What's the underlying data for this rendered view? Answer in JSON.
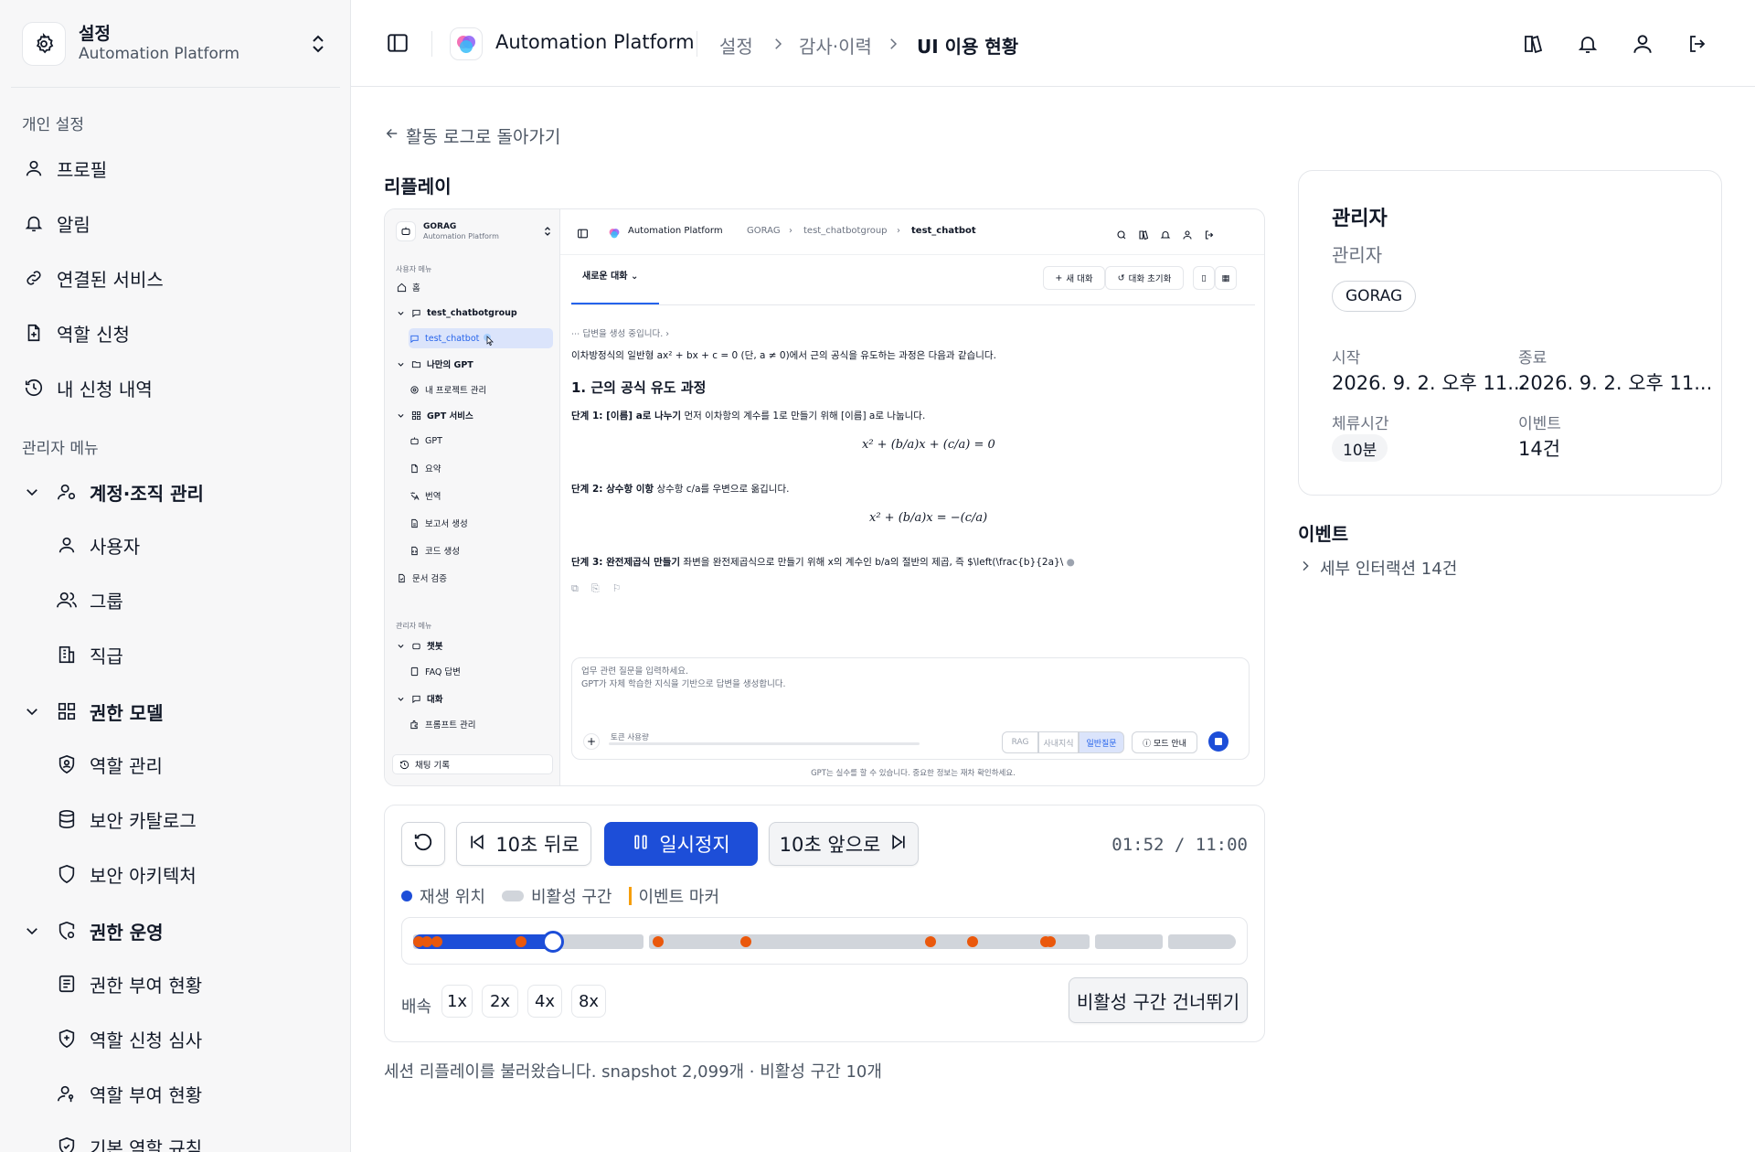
{
  "sidebar": {
    "workspace": {
      "title": "설정",
      "subtitle": "Automation Platform"
    },
    "personal_section": "개인 설정",
    "personal_items": [
      "프로필",
      "알림",
      "연결된 서비스",
      "역할 신청",
      "내 신청 내역"
    ],
    "admin_section": "관리자 메뉴",
    "groups": [
      {
        "label": "계정·조직 관리",
        "items": [
          "사용자",
          "그룹",
          "직급"
        ]
      },
      {
        "label": "권한 모델",
        "items": [
          "역할 관리",
          "보안 카탈로그",
          "보안 아키텍처"
        ]
      },
      {
        "label": "권한 운영",
        "items": [
          "권한 부여 현황",
          "역할 신청 심사",
          "역할 부여 현황",
          "기본 역할 규칙"
        ]
      }
    ]
  },
  "topbar": {
    "app_name": "Automation Platform",
    "breadcrumb": [
      "설정",
      "감사·이력",
      "UI 이용 현황"
    ]
  },
  "main": {
    "back_link": "활동 로그로 돌아가기",
    "replay_title": "리플레이",
    "status_text": "세션 리플레이를 불러왔습니다. snapshot 2,099개 · 비활성 구간 10개"
  },
  "replay": {
    "sidebar": {
      "workspace_title": "GORAG",
      "workspace_sub": "Automation Platform",
      "user_section": "사용자 메뉴",
      "admin_section": "관리자 메뉴",
      "home": "홈",
      "chatbotgroup": "test_chatbotgroup",
      "chatbot": "test_chatbot",
      "my_gpt": "나만의 GPT",
      "my_projects": "내 프로젝트 관리",
      "gpt_service": "GPT 서비스",
      "gpt": "GPT",
      "summary": "요약",
      "translate": "번역",
      "report": "보고서 생성",
      "code": "코드 생성",
      "doc_check": "문서 검증",
      "chatbot_admin": "챗봇",
      "faq": "FAQ 답변",
      "conversation": "대화",
      "prompt_admin": "프롬프트 관리",
      "chat_history": "채팅 기록"
    },
    "topbar": {
      "app_name": "Automation Platform",
      "crumbs": [
        "GORAG",
        "test_chatbotgroup",
        "test_chatbot"
      ]
    },
    "chat": {
      "tab": "새로운 대화",
      "new_chat": "새 대화",
      "reset_chat": "대화 초기화",
      "generating": "답변을 생성 중입니다.",
      "intro": "이차방정식의 일반형 ax² + bx + c = 0 (단, a ≠ 0)에서 근의 공식을 유도하는 과정은 다음과 같습니다.",
      "heading": "1. 근의 공식 유도 과정",
      "step1_title": "단계 1: [이름] a로 나누기",
      "step1_text": "먼저 이차항의 계수를 1로 만들기 위해 [이름] a로 나눕니다.",
      "eq1": "x² + (b/a)x + (c/a) = 0",
      "step2_title": "단계 2: 상수항 이항",
      "step2_text": "상수항 c/a를 우변으로 옮깁니다.",
      "eq2": "x² + (b/a)x = −(c/a)",
      "step3_title": "단계 3: 완전제곱식 만들기",
      "step3_text": "좌변을 완전제곱식으로 만들기 위해 x의 계수인 b/a의 절반의 제곱, 즉 $\\left(\\frac{b}{2a}\\",
      "input_placeholder_1": "업무 관련 질문을 입력하세요.",
      "input_placeholder_2": "GPT가 자체 학습한 지식을 기반으로 답변을 생성합니다.",
      "token_label": "토큰 사용량",
      "modes": [
        "RAG",
        "사내지식",
        "일반질문"
      ],
      "mode_guide": "모드 안내",
      "footer": "GPT는 실수를 할 수 있습니다. 중요한 정보는 재차 확인하세요."
    }
  },
  "controls": {
    "back10": "10초 뒤로",
    "pause": "일시정지",
    "fwd10": "10초 앞으로",
    "time": "01:52 / 11:00",
    "legend_position": "재생 위치",
    "legend_inactive": "비활성 구간",
    "legend_marker": "이벤트 마커",
    "progress_fraction": 0.17,
    "speed_label": "배속",
    "speeds": [
      "1x",
      "2x",
      "4x",
      "8x"
    ],
    "skip_inactive": "비활성 구간 건너뛰기"
  },
  "info_card": {
    "title": "관리자",
    "role": "관리자",
    "badge": "GORAG",
    "start_label": "시작",
    "start_value": "2026. 9. 2. 오후 11...",
    "end_label": "종료",
    "end_value": "2026. 9. 2. 오후 11...",
    "dwell_label": "체류시간",
    "dwell_value": "10분",
    "events_label": "이벤트",
    "events_value": "14건"
  },
  "events": {
    "title": "이벤트",
    "detail": "세부 인터랙션 14건"
  },
  "colors": {
    "accent": "#1d4ed8",
    "marker": "#ea580c",
    "inactive": "#d1d5db",
    "legend_marker": "#f59e0b"
  }
}
